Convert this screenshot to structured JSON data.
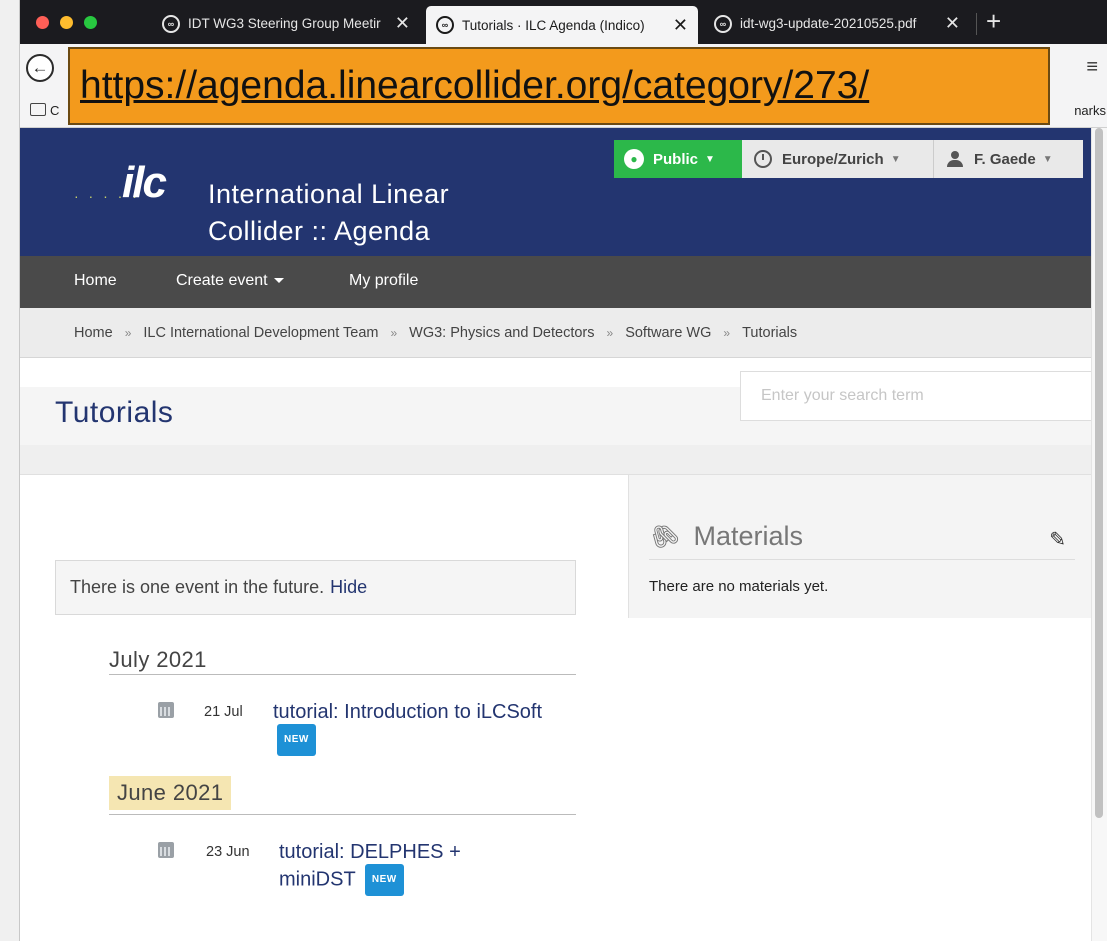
{
  "browser": {
    "tabs": [
      {
        "title": "IDT WG3 Steering Group Meetir",
        "close": "✕"
      },
      {
        "title": "Tutorials · ILC Agenda (Indico)",
        "close": "✕"
      },
      {
        "title": "idt-wg3-update-20210525.pdf",
        "close": "✕"
      }
    ],
    "new_tab": "+",
    "url": "https://agenda.linearcollider.org/category/273/",
    "bookmarks_left": "C",
    "bookmarks_right": "narks",
    "menu": "≡",
    "back": "←"
  },
  "header": {
    "logo_text": "ilc",
    "logo_dots": "· · · · ·",
    "site_title_line1": "International Linear",
    "site_title_line2": "Collider :: Agenda",
    "public_label": "Public",
    "timezone_label": "Europe/Zurich",
    "user_label": "F. Gaede",
    "caret": "▼"
  },
  "nav": {
    "home": "Home",
    "create_event": "Create event",
    "my_profile": "My profile"
  },
  "breadcrumb": {
    "items": [
      "Home",
      "ILC International Development Team",
      "WG3: Physics and Detectors",
      "Software WG",
      "Tutorials"
    ],
    "separator": "»"
  },
  "page": {
    "title": "Tutorials",
    "search_placeholder": "Enter your search term"
  },
  "future_notice": {
    "text": "There is one event in the future.",
    "hide_link": "Hide"
  },
  "months": [
    {
      "label": "July 2021",
      "events": [
        {
          "date": "21 Jul",
          "title": "tutorial: Introduction to iLCSoft",
          "badge": "NEW"
        }
      ]
    },
    {
      "label": "June 2021",
      "events": [
        {
          "date": "23 Jun",
          "title": "tutorial: DELPHES + miniDST",
          "badge": "NEW"
        }
      ]
    }
  ],
  "materials": {
    "title": "Materials",
    "empty_text": "There are no materials yet."
  },
  "colors": {
    "header_bg": "#233570",
    "nav_bg": "#4a4a4a",
    "public_green": "#2cb84a",
    "badge_blue": "#1e91d6",
    "url_callout": "#f39a1c"
  }
}
